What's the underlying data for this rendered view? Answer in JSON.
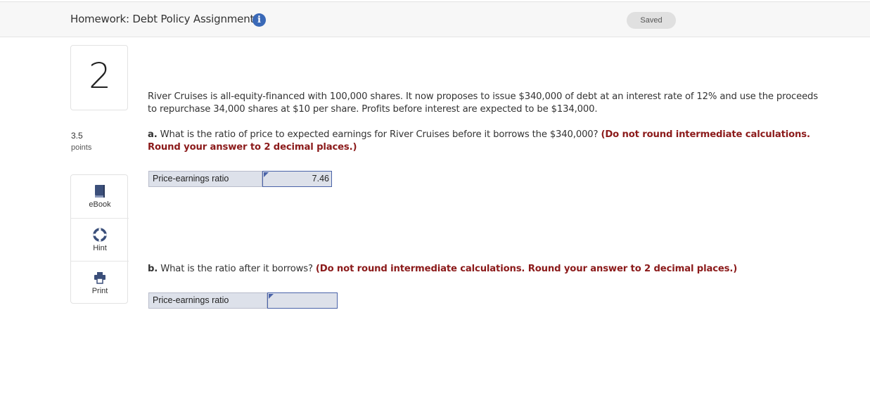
{
  "header": {
    "title": "Homework: Debt Policy Assignment",
    "info_icon": "info-icon",
    "saved_label": "Saved"
  },
  "question": {
    "number": "2",
    "points_value": "3.5",
    "points_label": "points",
    "text": "River Cruises is all-equity-financed with 100,000 shares. It now proposes to issue $340,000 of debt at an interest rate of 12% and use the proceeds to repurchase 34,000 shares at $10 per share. Profits before interest are expected to be $134,000."
  },
  "tools": [
    {
      "label": "eBook",
      "icon": "book-icon"
    },
    {
      "label": "Hint",
      "icon": "lifebuoy-icon"
    },
    {
      "label": "Print",
      "icon": "printer-icon"
    }
  ],
  "part_a": {
    "label": "a.",
    "text": "What is the ratio of price to expected earnings for River Cruises before it borrows the $340,000?",
    "instruction": "(Do not round intermediate calculations. Round your answer to 2 decimal places.)",
    "field_label": "Price-earnings ratio",
    "value": "7.46"
  },
  "part_b": {
    "label": "b.",
    "text": "What is the ratio after it borrows?",
    "instruction": "(Do not round intermediate calculations. Round your answer to 2 decimal places.)",
    "field_label": "Price-earnings ratio",
    "value": ""
  },
  "colors": {
    "accent": "#3a69b7",
    "instruction_red": "#8b1a1a",
    "input_bg": "#dde1ea"
  }
}
